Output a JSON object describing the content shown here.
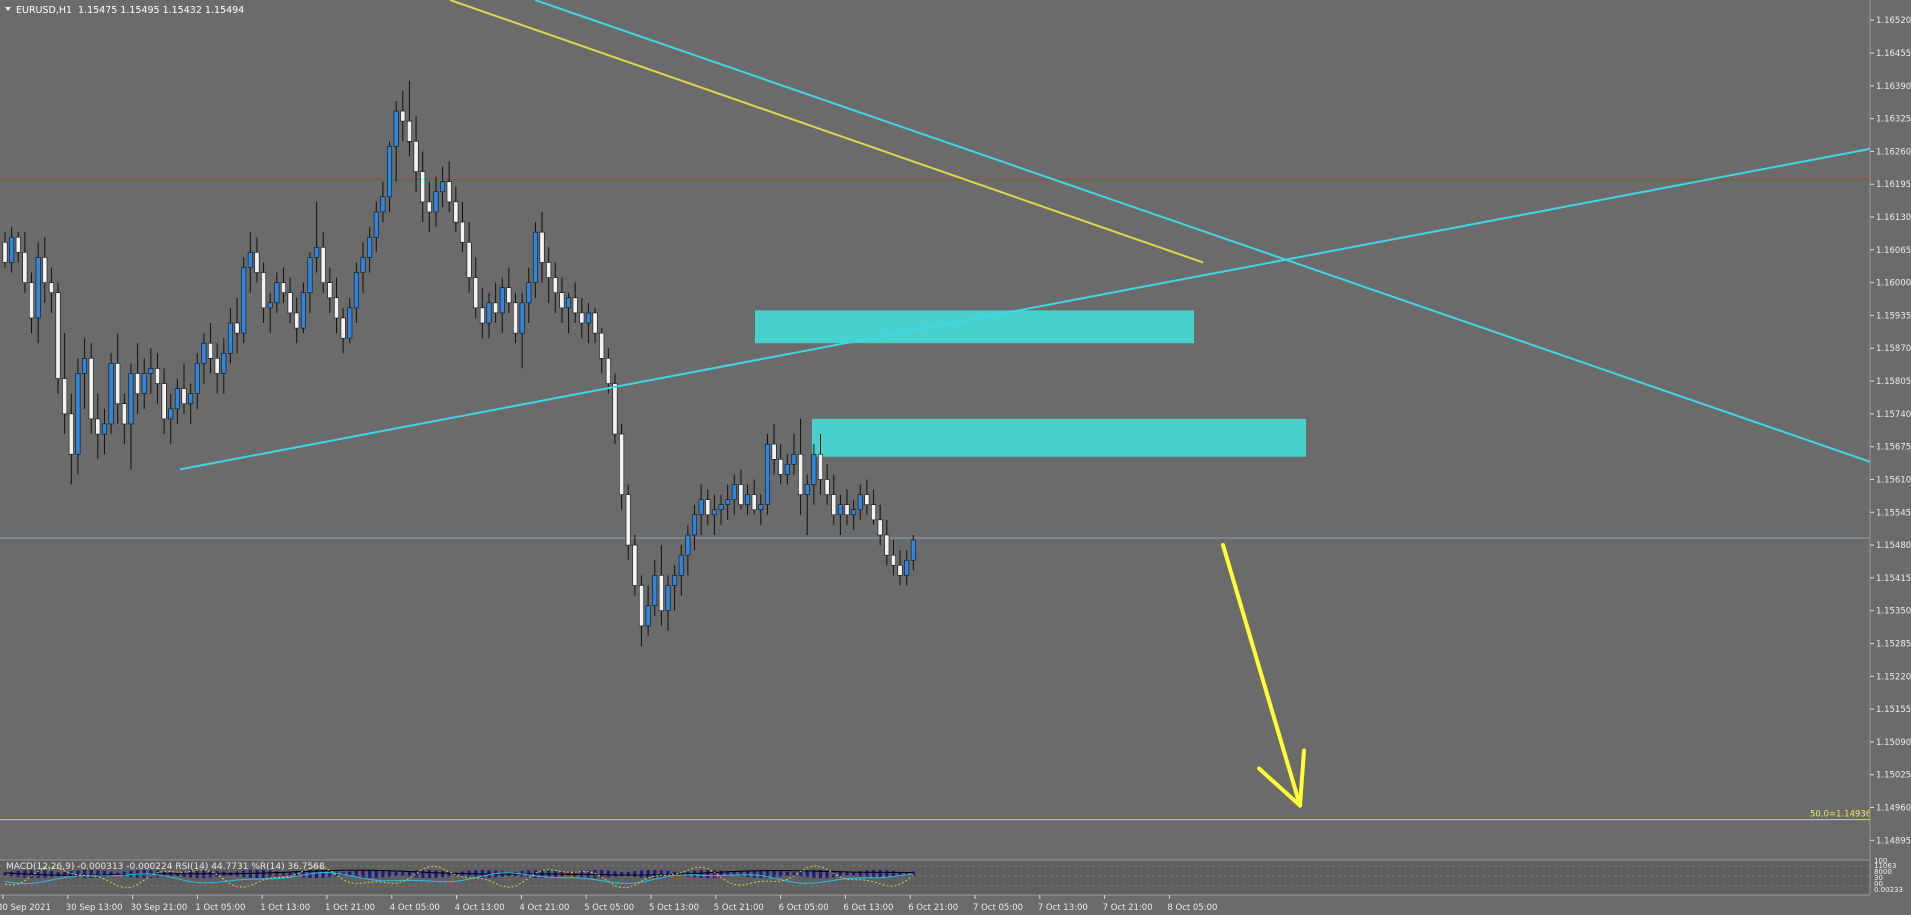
{
  "chart_data": {
    "type": "candlestick",
    "symbol": "EURUSD,H1",
    "ohlc_header": "1.15475 1.15495 1.15432 1.15494",
    "current_price": 1.15494,
    "current_price_label": "1.15494",
    "ylim": [
      1.1486,
      1.1656
    ],
    "y_ticks": [
      1.1652,
      1.16455,
      1.1639,
      1.16325,
      1.1626,
      1.16195,
      1.1613,
      1.16065,
      1.16,
      1.15935,
      1.1587,
      1.15805,
      1.1574,
      1.15675,
      1.1561,
      1.15545,
      1.1548,
      1.15415,
      1.1535,
      1.15285,
      1.1522,
      1.15155,
      1.1509,
      1.15025,
      1.1496,
      1.14895
    ],
    "y_tick_labels": [
      "1.16520",
      "1.16455",
      "1.16390",
      "1.16325",
      "1.16260",
      "1.16195",
      "1.16130",
      "1.16065",
      "1.16000",
      "1.15935",
      "1.15870",
      "1.15805",
      "1.15740",
      "1.15675",
      "1.15610",
      "1.15545",
      "1.15480",
      "1.15415",
      "1.15350",
      "1.15285",
      "1.15220",
      "1.15155",
      "1.15090",
      "1.15025",
      "1.14960",
      "1.14895"
    ],
    "x_tick_labels": [
      "30 Sep 2021",
      "30 Sep 13:00",
      "30 Sep 21:00",
      "1 Oct 05:00",
      "1 Oct 13:00",
      "1 Oct 21:00",
      "4 Oct 05:00",
      "4 Oct 13:00",
      "4 Oct 21:00",
      "5 Oct 05:00",
      "5 Oct 13:00",
      "5 Oct 21:00",
      "6 Oct 05:00",
      "6 Oct 13:00",
      "6 Oct 21:00",
      "7 Oct 05:00",
      "7 Oct 13:00",
      "7 Oct 21:00",
      "8 Oct 05:00"
    ],
    "candles": [
      [
        1.1608,
        1.161,
        1.1603,
        1.1604
      ],
      [
        1.1604,
        1.1611,
        1.1602,
        1.1609
      ],
      [
        1.1609,
        1.161,
        1.1604,
        1.1606
      ],
      [
        1.1606,
        1.161,
        1.1598,
        1.16
      ],
      [
        1.16,
        1.1602,
        1.159,
        1.1593
      ],
      [
        1.1593,
        1.1608,
        1.1588,
        1.1605
      ],
      [
        1.1605,
        1.1609,
        1.1596,
        1.16
      ],
      [
        1.16,
        1.1603,
        1.1594,
        1.1598
      ],
      [
        1.1598,
        1.16,
        1.1578,
        1.1581
      ],
      [
        1.1581,
        1.159,
        1.157,
        1.1574
      ],
      [
        1.1574,
        1.1578,
        1.156,
        1.1566
      ],
      [
        1.1566,
        1.1585,
        1.1562,
        1.1582
      ],
      [
        1.1582,
        1.1589,
        1.1575,
        1.1585
      ],
      [
        1.1585,
        1.1588,
        1.157,
        1.1573
      ],
      [
        1.1573,
        1.1578,
        1.1565,
        1.157
      ],
      [
        1.157,
        1.1575,
        1.1566,
        1.1572
      ],
      [
        1.1572,
        1.1586,
        1.157,
        1.1584
      ],
      [
        1.1584,
        1.159,
        1.1572,
        1.1576
      ],
      [
        1.1576,
        1.1578,
        1.1568,
        1.1572
      ],
      [
        1.1572,
        1.1584,
        1.1563,
        1.1582
      ],
      [
        1.1582,
        1.1588,
        1.1574,
        1.1578
      ],
      [
        1.1578,
        1.1585,
        1.1575,
        1.1582
      ],
      [
        1.1582,
        1.1587,
        1.1578,
        1.1583
      ],
      [
        1.1583,
        1.1586,
        1.1576,
        1.158
      ],
      [
        1.158,
        1.1583,
        1.157,
        1.1573
      ],
      [
        1.1573,
        1.1578,
        1.1568,
        1.1575
      ],
      [
        1.1575,
        1.1581,
        1.1572,
        1.1579
      ],
      [
        1.1579,
        1.1584,
        1.1574,
        1.1576
      ],
      [
        1.1576,
        1.158,
        1.1572,
        1.1578
      ],
      [
        1.1578,
        1.1586,
        1.1575,
        1.1584
      ],
      [
        1.1584,
        1.159,
        1.158,
        1.1588
      ],
      [
        1.1588,
        1.1592,
        1.1582,
        1.1585
      ],
      [
        1.1585,
        1.1588,
        1.1578,
        1.1582
      ],
      [
        1.1582,
        1.1589,
        1.1578,
        1.1586
      ],
      [
        1.1586,
        1.1595,
        1.1584,
        1.1592
      ],
      [
        1.1592,
        1.1597,
        1.1586,
        1.159
      ],
      [
        1.159,
        1.1605,
        1.1588,
        1.1603
      ],
      [
        1.1603,
        1.161,
        1.1598,
        1.1606
      ],
      [
        1.1606,
        1.1609,
        1.16,
        1.1602
      ],
      [
        1.1602,
        1.1604,
        1.1592,
        1.1595
      ],
      [
        1.1595,
        1.1598,
        1.159,
        1.1596
      ],
      [
        1.1596,
        1.1602,
        1.1594,
        1.16
      ],
      [
        1.16,
        1.1603,
        1.1596,
        1.1598
      ],
      [
        1.1598,
        1.1601,
        1.1592,
        1.1594
      ],
      [
        1.1594,
        1.1597,
        1.1588,
        1.1591
      ],
      [
        1.1591,
        1.16,
        1.159,
        1.1598
      ],
      [
        1.1598,
        1.1606,
        1.1594,
        1.1605
      ],
      [
        1.1605,
        1.1616,
        1.1602,
        1.1607
      ],
      [
        1.1607,
        1.161,
        1.1598,
        1.16
      ],
      [
        1.16,
        1.1603,
        1.1594,
        1.1597
      ],
      [
        1.1597,
        1.1601,
        1.159,
        1.1593
      ],
      [
        1.1593,
        1.1595,
        1.1586,
        1.1589
      ],
      [
        1.1589,
        1.1597,
        1.1588,
        1.1595
      ],
      [
        1.1595,
        1.1604,
        1.1592,
        1.1602
      ],
      [
        1.1602,
        1.1608,
        1.1598,
        1.1605
      ],
      [
        1.1605,
        1.1611,
        1.1602,
        1.1609
      ],
      [
        1.1609,
        1.1616,
        1.1606,
        1.1614
      ],
      [
        1.1614,
        1.162,
        1.1612,
        1.1617
      ],
      [
        1.1617,
        1.1628,
        1.1614,
        1.1627
      ],
      [
        1.1627,
        1.1636,
        1.162,
        1.1634
      ],
      [
        1.1634,
        1.1638,
        1.1628,
        1.1632
      ],
      [
        1.1632,
        1.164,
        1.1625,
        1.1628
      ],
      [
        1.1628,
        1.1633,
        1.1618,
        1.1622
      ],
      [
        1.1622,
        1.1626,
        1.1612,
        1.1616
      ],
      [
        1.1616,
        1.162,
        1.161,
        1.1614
      ],
      [
        1.1614,
        1.1621,
        1.1611,
        1.1618
      ],
      [
        1.1618,
        1.1623,
        1.1615,
        1.162
      ],
      [
        1.162,
        1.1624,
        1.1614,
        1.1616
      ],
      [
        1.1616,
        1.1619,
        1.161,
        1.1612
      ],
      [
        1.1612,
        1.1616,
        1.1606,
        1.1608
      ],
      [
        1.1608,
        1.1612,
        1.1598,
        1.1601
      ],
      [
        1.1601,
        1.1605,
        1.1593,
        1.1595
      ],
      [
        1.1595,
        1.1599,
        1.1589,
        1.1592
      ],
      [
        1.1592,
        1.1598,
        1.1589,
        1.1596
      ],
      [
        1.1596,
        1.16,
        1.1592,
        1.1594
      ],
      [
        1.1594,
        1.1601,
        1.159,
        1.1599
      ],
      [
        1.1599,
        1.1603,
        1.1594,
        1.1596
      ],
      [
        1.1596,
        1.1598,
        1.1588,
        1.159
      ],
      [
        1.159,
        1.1598,
        1.1583,
        1.1596
      ],
      [
        1.1596,
        1.1603,
        1.1592,
        1.16
      ],
      [
        1.16,
        1.1612,
        1.1597,
        1.161
      ],
      [
        1.161,
        1.1614,
        1.16,
        1.1604
      ],
      [
        1.1604,
        1.1607,
        1.1596,
        1.1601
      ],
      [
        1.1601,
        1.1604,
        1.1594,
        1.1598
      ],
      [
        1.1598,
        1.1601,
        1.1592,
        1.1595
      ],
      [
        1.1595,
        1.1598,
        1.159,
        1.1597
      ],
      [
        1.1597,
        1.16,
        1.1592,
        1.1594
      ],
      [
        1.1594,
        1.1597,
        1.1589,
        1.1592
      ],
      [
        1.1592,
        1.1596,
        1.1588,
        1.1594
      ],
      [
        1.1594,
        1.1595,
        1.1588,
        1.159
      ],
      [
        1.159,
        1.1591,
        1.1582,
        1.1585
      ],
      [
        1.1585,
        1.1587,
        1.1578,
        1.158
      ],
      [
        1.158,
        1.1582,
        1.1568,
        1.157
      ],
      [
        1.157,
        1.1572,
        1.1555,
        1.1558
      ],
      [
        1.1558,
        1.156,
        1.1545,
        1.1548
      ],
      [
        1.1548,
        1.155,
        1.1538,
        1.154
      ],
      [
        1.154,
        1.1542,
        1.1528,
        1.1532
      ],
      [
        1.1532,
        1.154,
        1.153,
        1.1536
      ],
      [
        1.1536,
        1.1545,
        1.1534,
        1.1542
      ],
      [
        1.1542,
        1.1548,
        1.1532,
        1.1535
      ],
      [
        1.1535,
        1.1542,
        1.1531,
        1.154
      ],
      [
        1.154,
        1.1544,
        1.1535,
        1.1542
      ],
      [
        1.1542,
        1.1548,
        1.1538,
        1.1546
      ],
      [
        1.1546,
        1.1552,
        1.1542,
        1.155
      ],
      [
        1.155,
        1.1556,
        1.1547,
        1.1554
      ],
      [
        1.1554,
        1.156,
        1.155,
        1.1557
      ],
      [
        1.1557,
        1.1559,
        1.1552,
        1.1554
      ],
      [
        1.1554,
        1.1558,
        1.155,
        1.1555
      ],
      [
        1.1555,
        1.1558,
        1.1552,
        1.1556
      ],
      [
        1.1556,
        1.156,
        1.1553,
        1.1557
      ],
      [
        1.1557,
        1.1562,
        1.1554,
        1.156
      ],
      [
        1.156,
        1.1563,
        1.1555,
        1.1556
      ],
      [
        1.1556,
        1.156,
        1.1554,
        1.1558
      ],
      [
        1.1558,
        1.1561,
        1.1554,
        1.1555
      ],
      [
        1.1555,
        1.1558,
        1.1552,
        1.1556
      ],
      [
        1.1556,
        1.157,
        1.1554,
        1.1568
      ],
      [
        1.1568,
        1.1572,
        1.1562,
        1.1565
      ],
      [
        1.1565,
        1.1568,
        1.156,
        1.1562
      ],
      [
        1.1562,
        1.1566,
        1.156,
        1.1564
      ],
      [
        1.1564,
        1.157,
        1.1562,
        1.1566
      ],
      [
        1.1566,
        1.1573,
        1.1554,
        1.1558
      ],
      [
        1.1558,
        1.1562,
        1.155,
        1.156
      ],
      [
        1.156,
        1.1568,
        1.1556,
        1.1566
      ],
      [
        1.1566,
        1.157,
        1.1558,
        1.1561
      ],
      [
        1.1561,
        1.1564,
        1.1556,
        1.1558
      ],
      [
        1.1558,
        1.1562,
        1.1552,
        1.1554
      ],
      [
        1.1554,
        1.1558,
        1.155,
        1.1556
      ],
      [
        1.1556,
        1.1559,
        1.1552,
        1.1554
      ],
      [
        1.1554,
        1.1557,
        1.1551,
        1.1555
      ],
      [
        1.1555,
        1.156,
        1.1553,
        1.1558
      ],
      [
        1.1558,
        1.1561,
        1.1554,
        1.1556
      ],
      [
        1.1556,
        1.1559,
        1.1552,
        1.1553
      ],
      [
        1.1553,
        1.1556,
        1.1548,
        1.155
      ],
      [
        1.155,
        1.1553,
        1.1544,
        1.1546
      ],
      [
        1.1546,
        1.1549,
        1.1542,
        1.1544
      ],
      [
        1.1544,
        1.1547,
        1.154,
        1.1542
      ],
      [
        1.1542,
        1.1547,
        1.154,
        1.1545
      ],
      [
        1.1545,
        1.155,
        1.1543,
        1.1549
      ]
    ],
    "horizontal_lines": [
      {
        "value": 1.16204,
        "color": "#e52a2a",
        "label": "1.16204"
      },
      {
        "value": 1.14936,
        "color": "#d9d54a",
        "label": "50.0=1.14936"
      }
    ],
    "zones": [
      {
        "top": 1.15945,
        "bottom": 1.1588,
        "color": "#48d1cc"
      },
      {
        "top": 1.1573,
        "bottom": 1.15655,
        "color": "#48d1cc"
      }
    ],
    "trendlines": [
      {
        "color": "#3fd6e6",
        "from": {
          "label": "30 Sep 21:00",
          "value": 1.1563
        },
        "to": {
          "label": "beyond 8 Oct 05:00",
          "value": 1.16265
        }
      },
      {
        "color": "#3fd6e6",
        "from": {
          "label": "4 Oct 13:00",
          "value": 1.1656
        },
        "to": {
          "label": "beyond 8 Oct 05:00",
          "value": 1.15645
        }
      },
      {
        "color": "#e0d54a",
        "from": {
          "label": "4 Oct 05:00",
          "value": 1.1656
        },
        "to": {
          "label": "7 Oct 21:00",
          "value": 1.1604
        }
      }
    ],
    "arrow": {
      "color": "#ffff33",
      "from": 1.1548,
      "to": 1.1496
    },
    "indicator_header": "MACD(12,26,9) -0.000313 -0.000224  RSI(14) 44.7731  %R(14) 36.7568",
    "indicator_scale_labels": [
      "100",
      "11063",
      "8000",
      "30",
      "00",
      "0.00233"
    ],
    "indicator_colors": {
      "macd_bars": "#1a1a8c",
      "signal": "#000000",
      "rsi": "#27c0e8",
      "wpr": "#d7cf40"
    }
  }
}
